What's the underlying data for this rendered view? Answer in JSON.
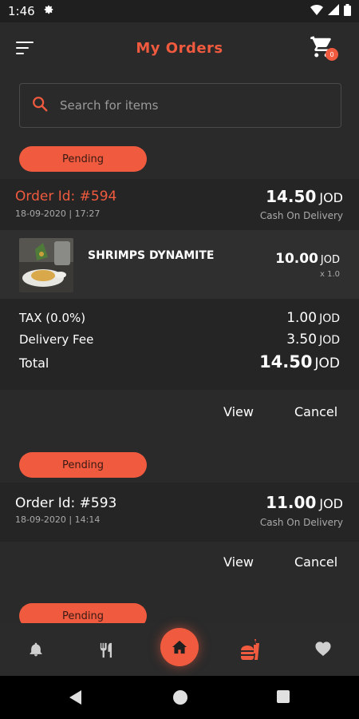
{
  "status_bar": {
    "time": "1:46"
  },
  "header": {
    "title": "My Orders",
    "cart_count": "0"
  },
  "search": {
    "placeholder": "Search for items"
  },
  "orders": [
    {
      "status": "Pending",
      "order_id": "Order Id: #594",
      "date": "18-09-2020 | 17:27",
      "total_amount": "14.50",
      "currency": "JOD",
      "payment": "Cash On Delivery",
      "items": [
        {
          "name": "SHRIMPS DYNAMITE",
          "price": "10.00",
          "currency": "JOD",
          "qty": "x 1.0"
        }
      ],
      "summary": {
        "tax_label": "TAX (0.0%)",
        "tax_value": "1.00",
        "delivery_label": "Delivery Fee",
        "delivery_value": "3.50",
        "total_label": "Total",
        "total_value": "14.50",
        "currency": "JOD"
      },
      "view_label": "View",
      "cancel_label": "Cancel"
    },
    {
      "status": "Pending",
      "order_id": "Order Id: #593",
      "date": "18-09-2020 | 14:14",
      "total_amount": "11.00",
      "currency": "JOD",
      "payment": "Cash On Delivery",
      "view_label": "View",
      "cancel_label": "Cancel"
    },
    {
      "status": "Pending"
    }
  ],
  "bottom_nav": {
    "items": [
      {
        "icon": "bell-icon"
      },
      {
        "icon": "fork-knife-icon"
      },
      {
        "icon": "home-icon"
      },
      {
        "icon": "burger-drink-icon"
      },
      {
        "icon": "heart-icon"
      }
    ]
  },
  "colors": {
    "accent": "#f05a3e",
    "background": "#2a2a2a",
    "card": "#252525",
    "item_row": "#2f2f2f"
  }
}
